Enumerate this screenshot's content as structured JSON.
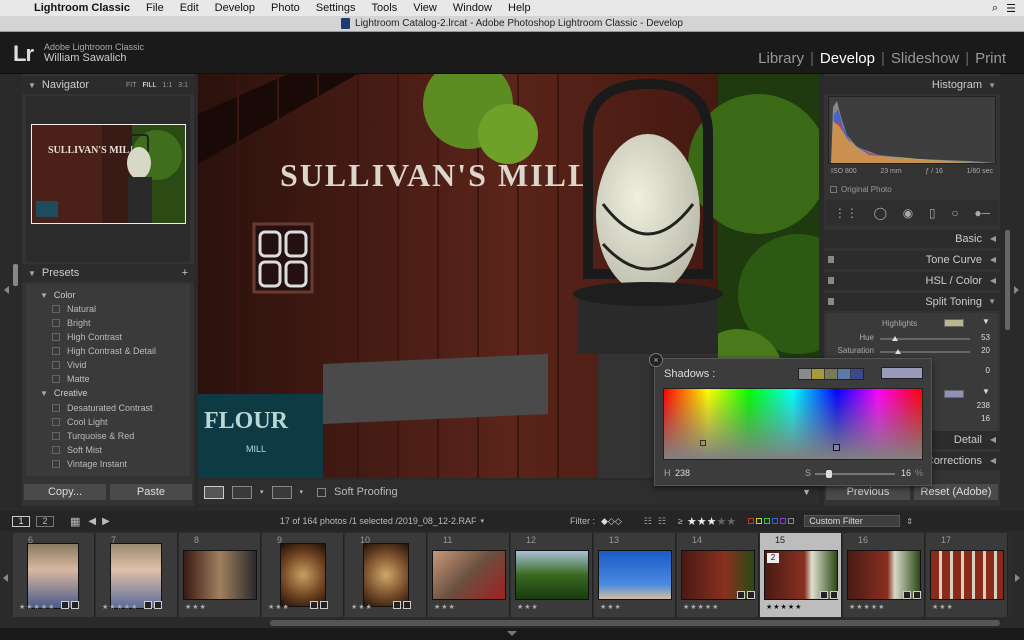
{
  "menubar": {
    "app_name": "Lightroom Classic",
    "items": [
      "File",
      "Edit",
      "Develop",
      "Photo",
      "Settings",
      "Tools",
      "View",
      "Window",
      "Help"
    ]
  },
  "window": {
    "title": "Lightroom Catalog-2.lrcat - Adobe Photoshop Lightroom Classic - Develop"
  },
  "identity": {
    "logo": "Lr",
    "product": "Adobe Lightroom Classic",
    "user": "William Sawalich"
  },
  "modules": [
    {
      "label": "Library",
      "active": false
    },
    {
      "label": "Develop",
      "active": true
    },
    {
      "label": "Slideshow",
      "active": false
    },
    {
      "label": "Print",
      "active": false
    }
  ],
  "navigator": {
    "title": "Navigator",
    "zoom": [
      "FIT",
      "FILL",
      "1:1",
      "3:1"
    ],
    "active_zoom": "FILL"
  },
  "presets": {
    "title": "Presets",
    "folders": [
      {
        "name": "Color",
        "items": [
          "Natural",
          "Bright",
          "High Contrast",
          "High Contrast & Detail",
          "Vivid",
          "Matte"
        ]
      },
      {
        "name": "Creative",
        "items": [
          "Desaturated Contrast",
          "Cool Light",
          "Turquoise & Red",
          "Soft Mist",
          "Vintage Instant"
        ]
      }
    ]
  },
  "left_buttons": {
    "copy": "Copy...",
    "paste": "Paste"
  },
  "toolbar": {
    "soft_proofing": "Soft Proofing"
  },
  "histogram": {
    "title": "Histogram",
    "iso": "ISO 800",
    "focal": "23 mm",
    "aperture": "ƒ / 16",
    "shutter": "1/60 sec",
    "original_photo": "Original Photo"
  },
  "right_sections": {
    "basic": "Basic",
    "tone_curve": "Tone Curve",
    "hsl": "HSL",
    "color": "Color",
    "split_toning": "Split Toning",
    "detail": "Detail",
    "corrections": "Corrections"
  },
  "split_toning": {
    "highlights_label": "Highlights",
    "hue_label": "Hue",
    "hue_value": "53",
    "sat_label": "Saturation",
    "sat_value": "20",
    "balance_value": "0",
    "shadow_hue_value": "238",
    "shadow_sat_value": "16"
  },
  "right_buttons": {
    "previous": "Previous",
    "reset": "Reset (Adobe)"
  },
  "popup": {
    "title": "Shadows :",
    "h_label": "H",
    "h_value": "238",
    "s_label": "S",
    "s_value": "16",
    "s_unit": "%"
  },
  "filmstrip_bar": {
    "page_left": "1",
    "page_right": "2",
    "info": "17 of 164 photos /1 selected /2019_08_12-2.RAF",
    "filter_label": "Filter :",
    "rating_op": "≥",
    "custom_filter": "Custom Filter"
  },
  "filmstrip": [
    {
      "num": "6",
      "stars": "★★★★★",
      "sel": false
    },
    {
      "num": "7",
      "stars": "★★★★★",
      "sel": false
    },
    {
      "num": "8",
      "stars": "★★★",
      "sel": false
    },
    {
      "num": "9",
      "stars": "★★★",
      "sel": false
    },
    {
      "num": "10",
      "stars": "★★★",
      "sel": false
    },
    {
      "num": "11",
      "stars": "★★★",
      "sel": false
    },
    {
      "num": "12",
      "stars": "★★★",
      "sel": false
    },
    {
      "num": "13",
      "stars": "★★★",
      "sel": false
    },
    {
      "num": "14",
      "stars": "★★★★★",
      "sel": false
    },
    {
      "num": "15",
      "stars": "★★★★★",
      "sel": true
    },
    {
      "num": "16",
      "stars": "★★★★★",
      "sel": false
    },
    {
      "num": "17",
      "stars": "★★★",
      "sel": false
    }
  ],
  "viewer_photo": {
    "sign_text": "SULLIVAN'S MILL",
    "flour_text": "FLOUR",
    "mill_text": "MILL"
  }
}
